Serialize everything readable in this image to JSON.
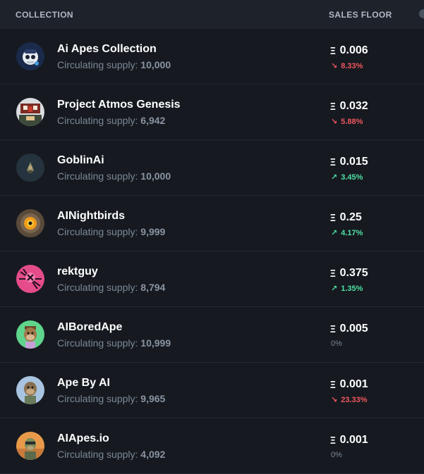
{
  "header": {
    "collection_label": "COLLECTION",
    "floor_label": "SALES FLOOR"
  },
  "currency_symbol": "Ξ",
  "supply_label": "Circulating supply:",
  "rows": [
    {
      "name": "Ai Apes Collection",
      "supply": "10,000",
      "price": "0.006",
      "change": "8.33%",
      "direction": "down",
      "avatar_icon": "ape-skull-avatar"
    },
    {
      "name": "Project Atmos Genesis",
      "supply": "6,942",
      "price": "0.032",
      "change": "5.88%",
      "direction": "down",
      "avatar_icon": "atmos-avatar"
    },
    {
      "name": "GoblinAi",
      "supply": "10,000",
      "price": "0.015",
      "change": "3.45%",
      "direction": "up",
      "avatar_icon": "goblin-avatar"
    },
    {
      "name": "AINightbirds",
      "supply": "9,999",
      "price": "0.25",
      "change": "4.17%",
      "direction": "up",
      "avatar_icon": "nightbird-eye-avatar"
    },
    {
      "name": "rektguy",
      "supply": "8,794",
      "price": "0.375",
      "change": "1.35%",
      "direction": "up",
      "avatar_icon": "rektguy-avatar"
    },
    {
      "name": "AIBoredApe",
      "supply": "10,999",
      "price": "0.005",
      "change": "0%",
      "direction": "flat",
      "avatar_icon": "bored-ape-avatar"
    },
    {
      "name": "Ape By AI",
      "supply": "9,965",
      "price": "0.001",
      "change": "23.33%",
      "direction": "down",
      "avatar_icon": "ape-by-ai-avatar"
    },
    {
      "name": "AIApes.io",
      "supply": "4,092",
      "price": "0.001",
      "change": "0%",
      "direction": "flat",
      "avatar_icon": "ai-apes-io-avatar"
    }
  ],
  "colors": {
    "background": "#161a20",
    "header_bg": "#1e232b",
    "down": "#f0555e",
    "up": "#4fe0a4",
    "muted": "#7d8796"
  }
}
